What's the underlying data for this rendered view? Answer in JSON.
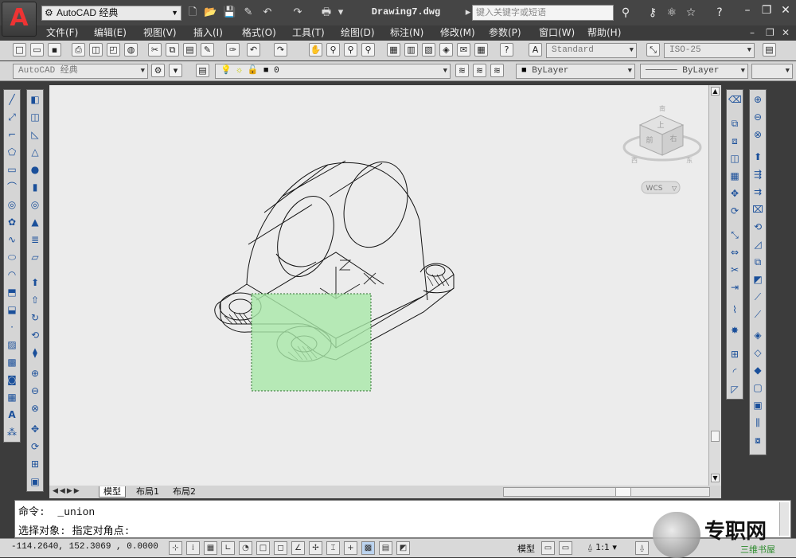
{
  "app": {
    "logo_glyph": "A",
    "workspace": "AutoCAD 经典",
    "document_title": "Drawing7.dwg",
    "search_placeholder": "键入关键字或短语"
  },
  "menu": [
    "文件(F)",
    "编辑(E)",
    "视图(V)",
    "插入(I)",
    "格式(O)",
    "工具(T)",
    "绘图(D)",
    "标注(N)",
    "修改(M)",
    "参数(P)",
    "窗口(W)",
    "帮助(H)"
  ],
  "styles": {
    "text_style": "Standard",
    "dim_style": "ISO-25"
  },
  "layers": {
    "workspace": "AutoCAD 经典",
    "current_layer": "0"
  },
  "properties": {
    "color": "ByLayer",
    "linetype": "ByLayer"
  },
  "viewcube": {
    "top_label": "上",
    "front_label": "前",
    "right_label": "右",
    "wcs_label": "WCS",
    "compass_w": "西",
    "compass_e": "东",
    "compass_s": "南"
  },
  "tabs": [
    "模型",
    "布局1",
    "布局2"
  ],
  "command": {
    "line1": "命令:  _union",
    "line2": "选择对象: 指定对角点:"
  },
  "status": {
    "coordinates": "-114.2640, 152.3069 , 0.0000",
    "model_label": "模型",
    "scale": "1:1"
  },
  "watermark": {
    "title": "专职网",
    "subtitle": "三维书屋"
  },
  "colors": {
    "selection_fill": "#a9e8a9",
    "canvas": "#ececec",
    "chrome": "#3c3c3c"
  }
}
